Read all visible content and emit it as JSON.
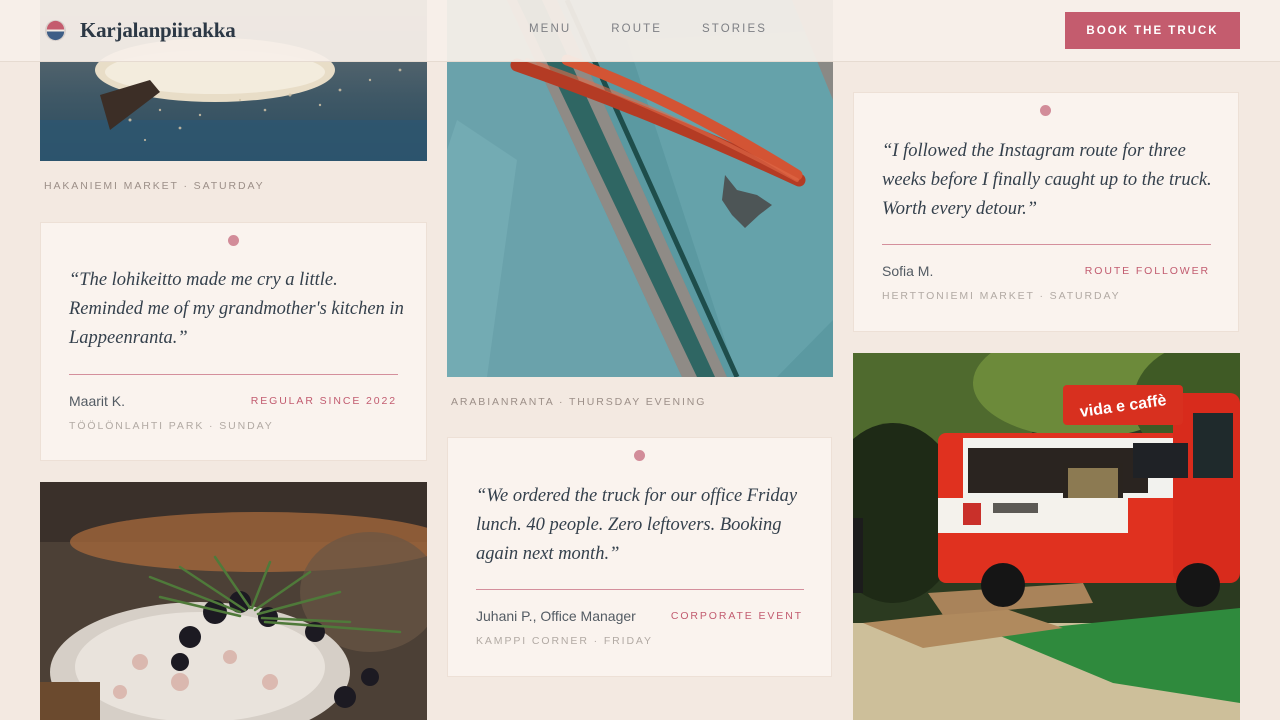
{
  "header": {
    "brand": "Karjalanpiirakka",
    "nav": [
      "MENU",
      "ROUTE",
      "STORIES"
    ],
    "cta": "BOOK THE TRUCK"
  },
  "photos": {
    "top_left_caption": "HAKANIEMI MARKET · SATURDAY",
    "bench_caption": "ARABIANRANTA · THURSDAY EVENING",
    "truck_sign": "vida e caffè"
  },
  "testimonials": [
    {
      "quote": "“The lohikeitto made me cry a little. Reminded me of my grandmother's kitchen in Lappeenranta.”",
      "author": "Maarit K.",
      "tag": "REGULAR SINCE 2022",
      "place": "TÖÖLÖNLAHTI PARK · SUNDAY"
    },
    {
      "quote": "“We ordered the truck for our office Friday lunch. 40 people. Zero leftovers. Booking again next month.”",
      "author": "Juhani P., Office Manager",
      "tag": "CORPORATE EVENT",
      "place": "KAMPPI CORNER · FRIDAY"
    },
    {
      "quote": "“I followed the Instagram route for three weeks before I finally caught up to the truck. Worth every detour.”",
      "author": "Sofia M.",
      "tag": "ROUTE FOLLOWER",
      "place": "HERTTONIEMI MARKET · SATURDAY"
    }
  ]
}
